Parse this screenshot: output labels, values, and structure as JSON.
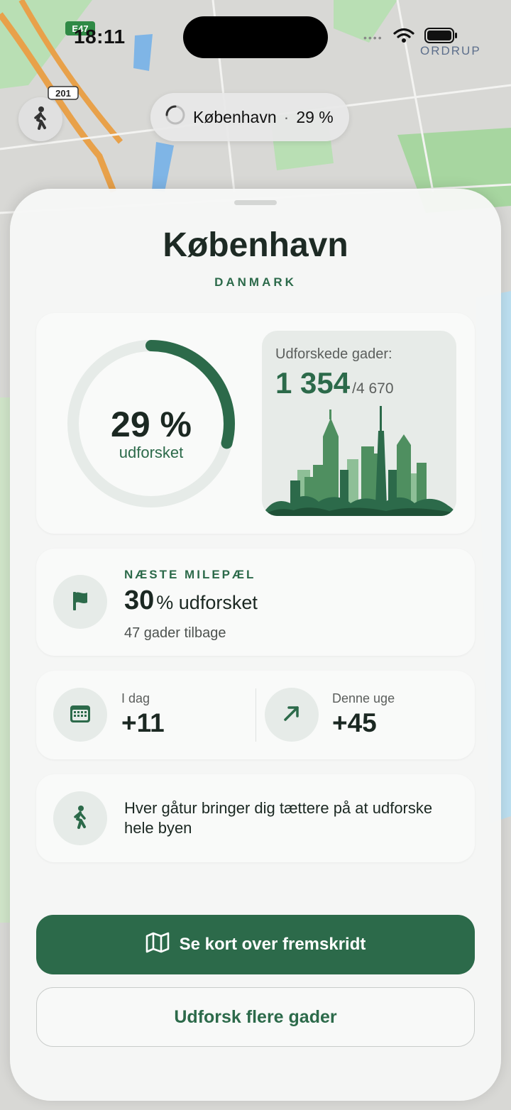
{
  "status_bar": {
    "time": "18:11",
    "map_label": "ORDRUP",
    "road_badge": "E47",
    "road_number": "201"
  },
  "city_pill": {
    "city": "København",
    "separator": "·",
    "percent": "29 %"
  },
  "sheet": {
    "title": "København",
    "country": "DANMARK",
    "ring": {
      "percent_text": "29 %",
      "label": "udforsket",
      "progress": 0.29
    },
    "streets": {
      "label": "Udforskede gader:",
      "explored": "1 354",
      "total": "/4 670"
    },
    "milestone": {
      "label": "NÆSTE MILEPÆL",
      "number": "30",
      "text": "% udforsket",
      "sub": "47 gader tilbage"
    },
    "today": {
      "label": "I dag",
      "value": "+11"
    },
    "week": {
      "label": "Denne uge",
      "value": "+45"
    },
    "tip": {
      "text": "Hver gåtur bringer dig tættere på at udforske hele byen"
    },
    "buttons": {
      "primary": "Se kort over fremskridt",
      "secondary": "Udforsk flere gader"
    }
  },
  "colors": {
    "accent": "#2c6a4a",
    "ring_track": "#e6ebe8",
    "text_dark": "#1b2822"
  },
  "icons": [
    "walking-icon",
    "spinner-icon",
    "flag-icon",
    "calendar-icon",
    "arrow-up-right-icon",
    "map-icon",
    "wifi-icon",
    "battery-icon"
  ]
}
